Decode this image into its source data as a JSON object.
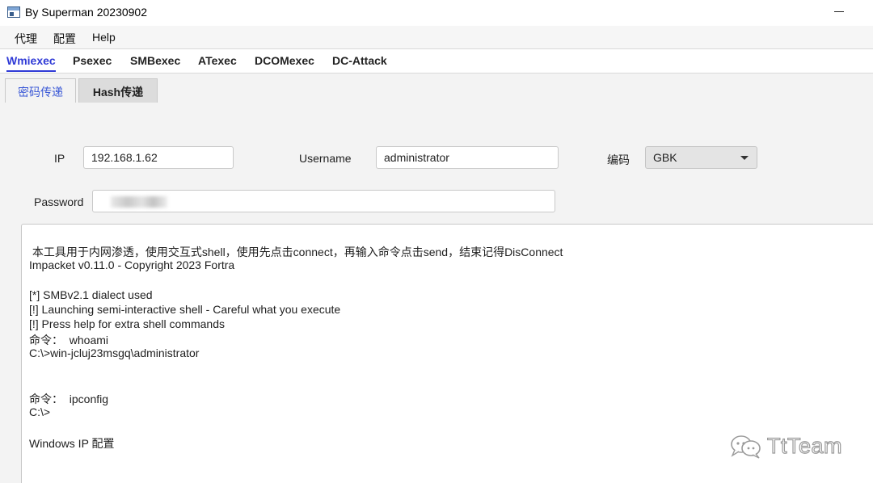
{
  "window": {
    "title": "By Superman 20230902"
  },
  "menu": {
    "items": [
      "代理",
      "配置",
      "Help"
    ]
  },
  "top_tabs": [
    "Wmiexec",
    "Psexec",
    "SMBexec",
    "ATexec",
    "DCOMexec",
    "DC-Attack"
  ],
  "sub_tabs": [
    "密码传递",
    "Hash传递"
  ],
  "form": {
    "ip_label": "IP",
    "ip_value": "192.168.1.62",
    "username_label": "Username",
    "username_value": "administrator",
    "encoding_label": "编码",
    "encoding_value": "GBK",
    "password_label": "Password"
  },
  "console": {
    "lines": [
      " 本工具用于内网渗透，使用交互式shell，使用先点击connect，再输入命令点击send，结束记得DisConnect",
      "Impacket v0.11.0 - Copyright 2023 Fortra",
      "",
      "[*] SMBv2.1 dialect used",
      "[!] Launching semi-interactive shell - Careful what you execute",
      "[!] Press help for extra shell commands",
      "命令：  whoami",
      "C:\\>win-jcluj23msgq\\administrator",
      "",
      "",
      "命令：  ipconfig",
      "C:\\>",
      "",
      "Windows IP 配置"
    ]
  },
  "watermark": {
    "text": "TtTeam"
  },
  "colors": {
    "accent": "#2f3ad6",
    "panel_bg": "#f3f3f3"
  }
}
